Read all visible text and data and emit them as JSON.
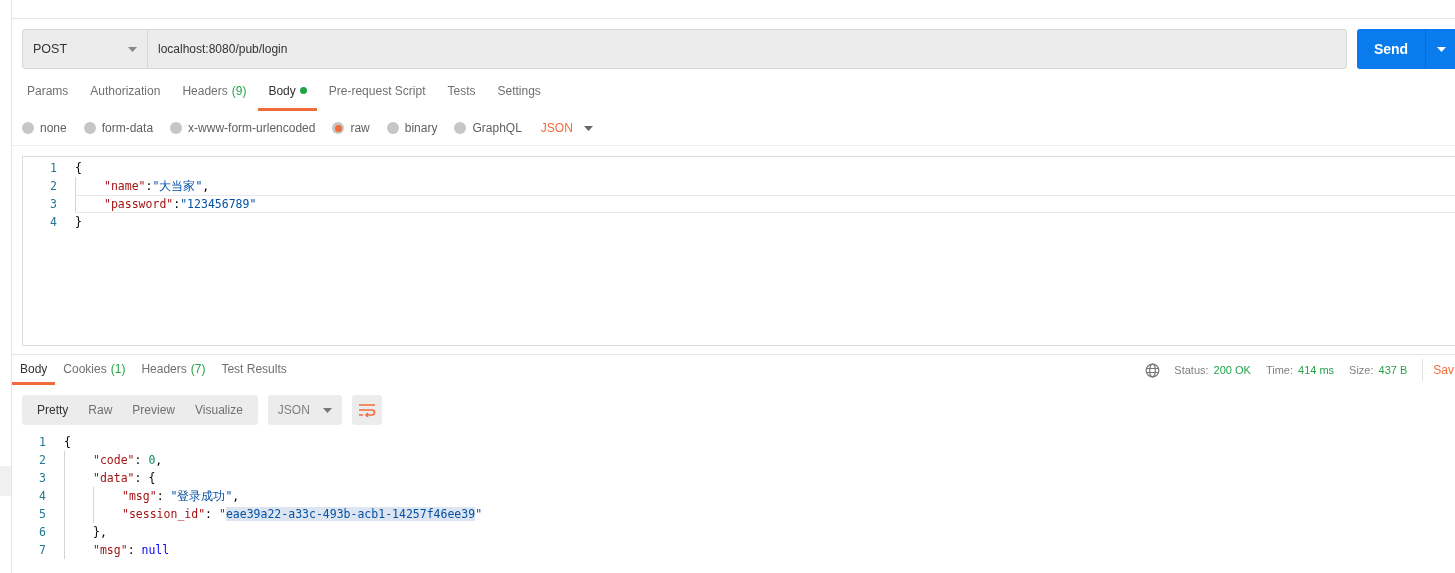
{
  "request": {
    "method": "POST",
    "url": "localhost:8080/pub/login",
    "send_label": "Send"
  },
  "request_tabs": [
    {
      "label": "Params",
      "selected": false,
      "dot": false
    },
    {
      "label": "Authorization",
      "selected": false,
      "dot": false
    },
    {
      "label": "Headers",
      "count": "(9)",
      "selected": false,
      "dot": false
    },
    {
      "label": "Body",
      "selected": true,
      "dot": true
    },
    {
      "label": "Pre-request Script",
      "selected": false,
      "dot": false
    },
    {
      "label": "Tests",
      "selected": false,
      "dot": false
    },
    {
      "label": "Settings",
      "selected": false,
      "dot": false
    }
  ],
  "body_types": [
    {
      "label": "none",
      "selected": false
    },
    {
      "label": "form-data",
      "selected": false
    },
    {
      "label": "x-www-form-urlencoded",
      "selected": false
    },
    {
      "label": "raw",
      "selected": true
    },
    {
      "label": "binary",
      "selected": false
    },
    {
      "label": "GraphQL",
      "selected": false
    }
  ],
  "body_language": "JSON",
  "request_body": [
    {
      "num": "1",
      "active": false,
      "tokens": [
        {
          "text": "{",
          "kind": "punct"
        }
      ],
      "children": [
        {
          "num": "2",
          "active": false,
          "tokens": [
            {
              "text": "\"name\"",
              "kind": "key"
            },
            {
              "text": ":",
              "kind": "punct"
            },
            {
              "text": "\"大当家\"",
              "kind": "string"
            },
            {
              "text": ",",
              "kind": "punct"
            }
          ]
        },
        {
          "num": "3",
          "active": true,
          "tokens": [
            {
              "text": "\"password\"",
              "kind": "key"
            },
            {
              "text": ":",
              "kind": "punct"
            },
            {
              "text": "\"123456789\"",
              "kind": "string"
            }
          ]
        }
      ]
    },
    {
      "num": "4",
      "active": false,
      "tokens": [
        {
          "text": "}",
          "kind": "punct"
        }
      ]
    }
  ],
  "response_tabs": [
    {
      "label": "Body",
      "selected": true
    },
    {
      "label": "Cookies",
      "count": "(1)",
      "selected": false
    },
    {
      "label": "Headers",
      "count": "(7)",
      "selected": false
    },
    {
      "label": "Test Results",
      "selected": false
    }
  ],
  "response_meta": [
    {
      "label": "Status:",
      "value": "200 OK"
    },
    {
      "label": "Time:",
      "value": "414 ms"
    },
    {
      "label": "Size:",
      "value": "437 B"
    }
  ],
  "save_label": "Sav",
  "view_modes": [
    {
      "label": "Pretty",
      "selected": true
    },
    {
      "label": "Raw",
      "selected": false
    },
    {
      "label": "Preview",
      "selected": false
    },
    {
      "label": "Visualize",
      "selected": false
    }
  ],
  "response_format": "JSON",
  "wrap_enabled": true,
  "response_body": [
    {
      "num": "1",
      "tokens": [
        {
          "text": "{",
          "kind": "punct"
        }
      ],
      "children": [
        {
          "num": "2",
          "tokens": [
            {
              "text": "\"code\"",
              "kind": "key"
            },
            {
              "text": ": ",
              "kind": "punct"
            },
            {
              "text": "0",
              "kind": "number"
            },
            {
              "text": ",",
              "kind": "punct"
            }
          ]
        },
        {
          "num": "3",
          "tokens": [
            {
              "text": "\"data\"",
              "kind": "key"
            },
            {
              "text": ": {",
              "kind": "punct"
            }
          ],
          "children": [
            {
              "num": "4",
              "tokens": [
                {
                  "text": "\"msg\"",
                  "kind": "key"
                },
                {
                  "text": ": ",
                  "kind": "punct"
                },
                {
                  "text": "\"登录成功\"",
                  "kind": "string"
                },
                {
                  "text": ",",
                  "kind": "punct"
                }
              ]
            },
            {
              "num": "5",
              "tokens": [
                {
                  "text": "\"session_id\"",
                  "kind": "key"
                },
                {
                  "text": ": ",
                  "kind": "punct"
                },
                {
                  "text": "\"",
                  "kind": "string",
                  "selected": false
                },
                {
                  "text": "eae39a22-a33c-493b-acb1-14257f46ee39",
                  "kind": "string",
                  "selected": true
                },
                {
                  "text": "\"",
                  "kind": "string",
                  "selected": false
                }
              ]
            }
          ]
        },
        {
          "num": "6",
          "tokens": [
            {
              "text": "},",
              "kind": "punct"
            }
          ]
        },
        {
          "num": "7",
          "tokens": [
            {
              "text": "\"msg\"",
              "kind": "key"
            },
            {
              "text": ": ",
              "kind": "punct"
            },
            {
              "text": "null",
              "kind": "null"
            }
          ]
        }
      ]
    }
  ]
}
